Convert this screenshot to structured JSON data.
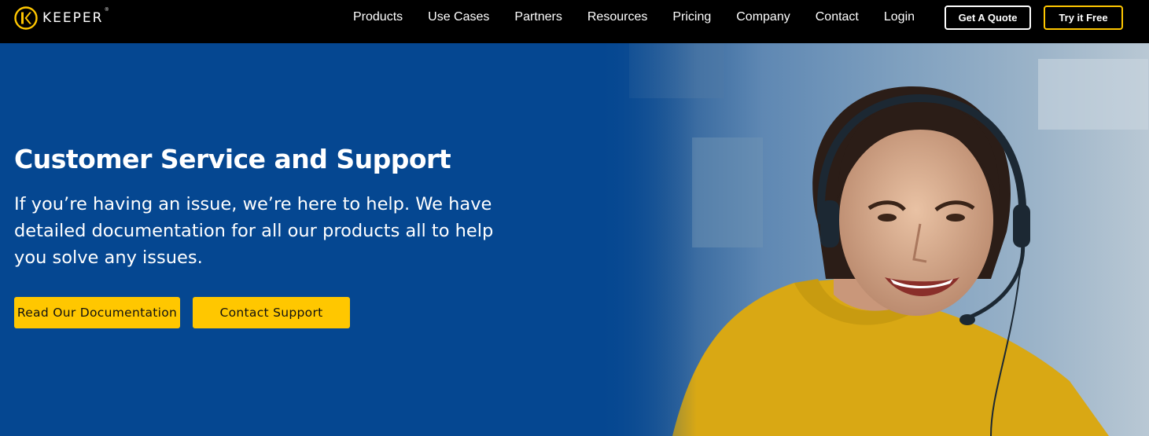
{
  "brand": {
    "name": "KEEPER",
    "trademark": "®",
    "accent_color": "#ffc700",
    "logo_icon": "keeper-logo-icon"
  },
  "nav": {
    "items": [
      {
        "label": "Products"
      },
      {
        "label": "Use Cases"
      },
      {
        "label": "Partners"
      },
      {
        "label": "Resources"
      },
      {
        "label": "Pricing"
      },
      {
        "label": "Company"
      },
      {
        "label": "Contact"
      },
      {
        "label": "Login"
      }
    ],
    "quote_label": "Get A Quote",
    "try_label": "Try it Free"
  },
  "hero": {
    "title": "Customer Service and Support",
    "body": "If you’re having an issue, we’re here to help. We have detailed documentation for all our products all to help you solve any issues.",
    "primary_cta": "Read Our Documentation",
    "secondary_cta": "Contact Support",
    "background_color": "#054791",
    "image_subject": "support-agent-photo"
  }
}
